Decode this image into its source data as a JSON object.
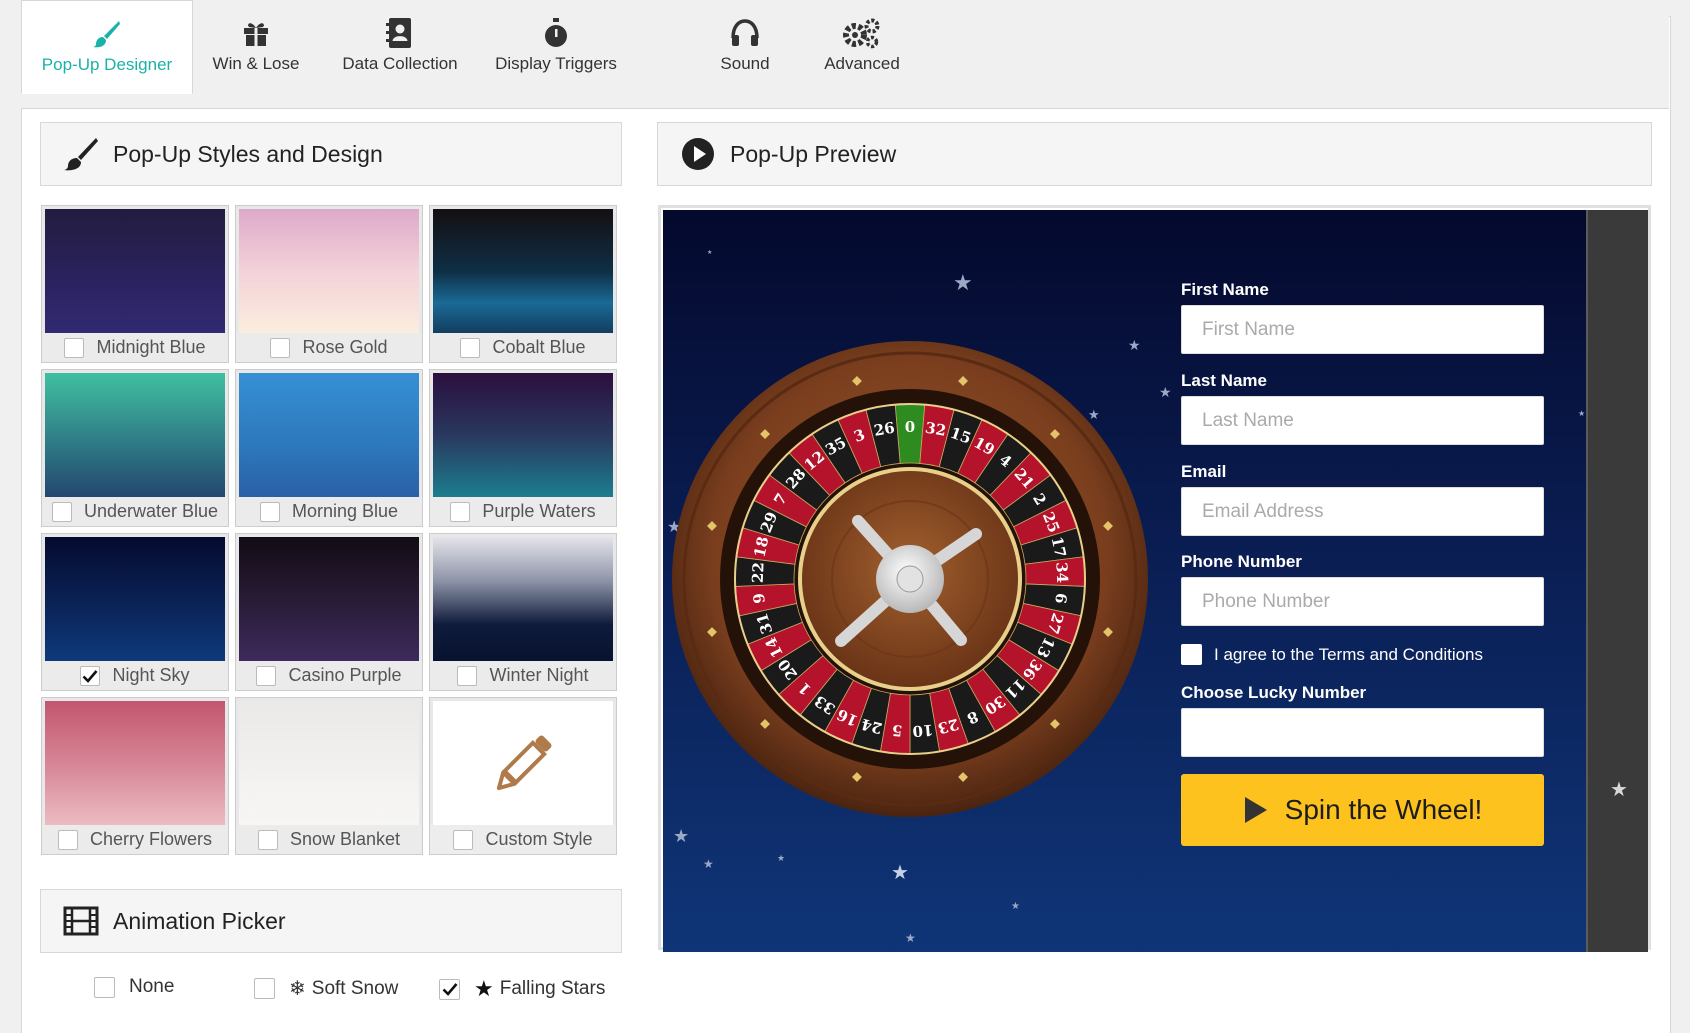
{
  "tabs": [
    {
      "label": "Pop-Up Designer",
      "icon": "brush-icon"
    },
    {
      "label": "Win & Lose",
      "icon": "gift-icon"
    },
    {
      "label": "Data Collection",
      "icon": "contact-book-icon"
    },
    {
      "label": "Display Triggers",
      "icon": "stopwatch-icon"
    },
    {
      "label": "Sound",
      "icon": "headphones-icon"
    },
    {
      "label": "Advanced",
      "icon": "gears-icon"
    }
  ],
  "active_tab": "Pop-Up Designer",
  "styles_panel": {
    "title": "Pop-Up Styles and Design",
    "styles": [
      {
        "name": "Midnight Blue",
        "checked": false
      },
      {
        "name": "Rose Gold",
        "checked": false
      },
      {
        "name": "Cobalt Blue",
        "checked": false
      },
      {
        "name": "Underwater Blue",
        "checked": false
      },
      {
        "name": "Morning Blue",
        "checked": false
      },
      {
        "name": "Purple Waters",
        "checked": false
      },
      {
        "name": "Night Sky",
        "checked": true
      },
      {
        "name": "Casino Purple",
        "checked": false
      },
      {
        "name": "Winter Night",
        "checked": false
      },
      {
        "name": "Cherry Flowers",
        "checked": false
      },
      {
        "name": "Snow Blanket",
        "checked": false
      },
      {
        "name": "Custom Style",
        "checked": false
      }
    ]
  },
  "animation_panel": {
    "title": "Animation Picker",
    "options": [
      {
        "label": "None",
        "checked": false,
        "icon": ""
      },
      {
        "label": "Soft Snow",
        "checked": false,
        "icon": "snowflake-icon"
      },
      {
        "label": "Falling Stars",
        "checked": true,
        "icon": "star-icon"
      }
    ]
  },
  "preview_panel": {
    "title": "Pop-Up Preview",
    "form": {
      "first_name_label": "First Name",
      "first_name_placeholder": "First Name",
      "last_name_label": "Last Name",
      "last_name_placeholder": "Last Name",
      "email_label": "Email",
      "email_placeholder": "Email Address",
      "phone_label": "Phone Number",
      "phone_placeholder": "Phone Number",
      "terms_label": "I agree to the Terms and Conditions",
      "lucky_label": "Choose Lucky Number",
      "lucky_value": "",
      "spin_button": "Spin the Wheel!"
    },
    "wheel_numbers": [
      "0",
      "32",
      "15",
      "19",
      "4",
      "21",
      "2",
      "25",
      "17",
      "34",
      "6",
      "27",
      "13",
      "36",
      "11",
      "30",
      "8",
      "23",
      "10",
      "5",
      "24",
      "16",
      "33",
      "1",
      "20",
      "14",
      "31",
      "9",
      "22",
      "18",
      "29",
      "7",
      "28",
      "12",
      "35",
      "3",
      "26"
    ]
  },
  "colors": {
    "accent": "#1ab2a8",
    "spin_button": "#fdc21e",
    "wheel_red": "#b5122b",
    "wheel_black": "#1a1a1a",
    "wheel_green": "#2e8b1f"
  }
}
